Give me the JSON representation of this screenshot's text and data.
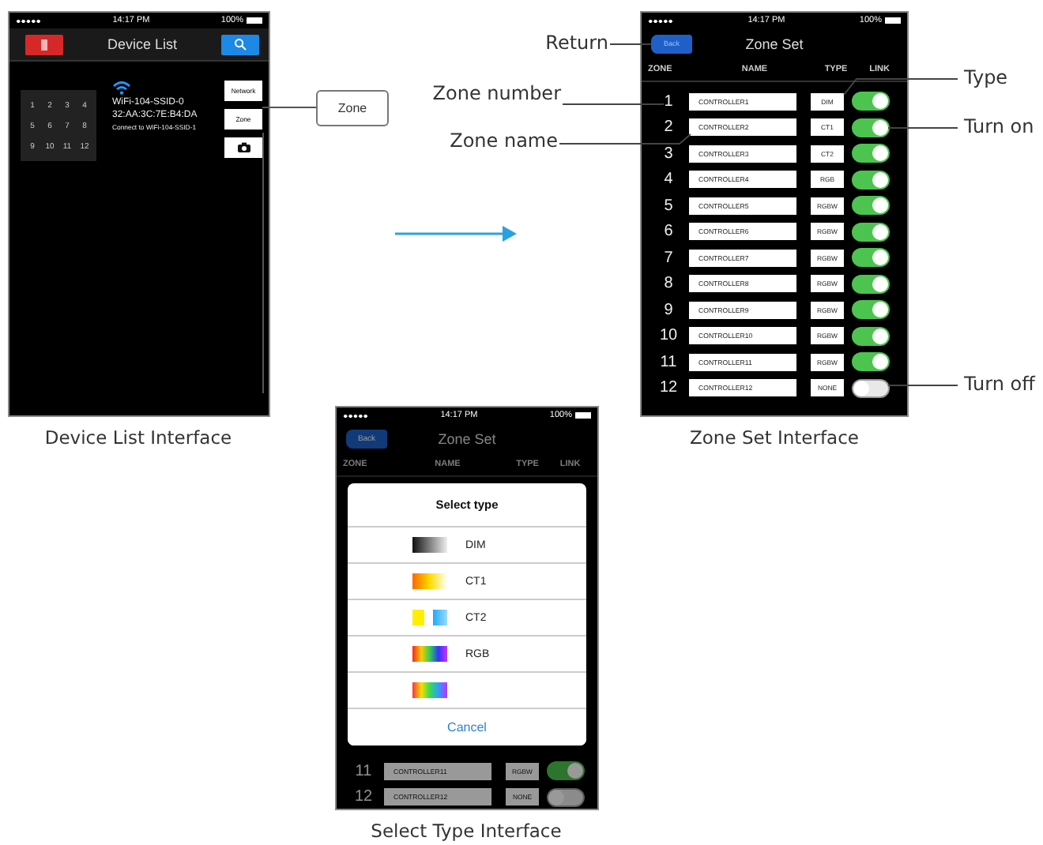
{
  "device_list_screen": {
    "status_bar": {
      "time": "14:17 PM",
      "battery": "100%"
    },
    "title": "Device List",
    "zone_grid": [
      "1",
      "2",
      "3",
      "4",
      "5",
      "6",
      "7",
      "8",
      "9",
      "10",
      "11",
      "12"
    ],
    "device": {
      "ssid": "WiFi-104-SSID-0",
      "mac": "32:AA:3C:7E:B4:DA",
      "connection": "Connect to WiFi-104-SSID-1"
    },
    "side_buttons": [
      {
        "kind": "text",
        "label": "Network"
      },
      {
        "kind": "text",
        "label": "Zone"
      },
      {
        "kind": "camera"
      }
    ],
    "caption": "Device List Interface"
  },
  "zone_callout": "Zone",
  "zone_set_screen": {
    "status_bar": {
      "time": "14:17 PM",
      "battery": "100%"
    },
    "back_button": "Back",
    "title": "Zone Set",
    "columns": [
      "ZONE",
      "NAME",
      "TYPE",
      "LINK"
    ],
    "rows": [
      {
        "zone": "1",
        "name": "CONTROLLER1",
        "type": "DIM",
        "on": true
      },
      {
        "zone": "2",
        "name": "CONTROLLER2",
        "type": "CT1",
        "on": true
      },
      {
        "zone": "3",
        "name": "CONTROLLER3",
        "type": "CT2",
        "on": true
      },
      {
        "zone": "4",
        "name": "CONTROLLER4",
        "type": "RGB",
        "on": true
      },
      {
        "zone": "5",
        "name": "CONTROLLER5",
        "type": "RGBW",
        "on": true
      },
      {
        "zone": "6",
        "name": "CONTROLLER6",
        "type": "RGBW",
        "on": true
      },
      {
        "zone": "7",
        "name": "CONTROLLER7",
        "type": "RGBW",
        "on": true
      },
      {
        "zone": "8",
        "name": "CONTROLLER8",
        "type": "RGBW",
        "on": true
      },
      {
        "zone": "9",
        "name": "CONTROLLER9",
        "type": "RGBW",
        "on": true
      },
      {
        "zone": "10",
        "name": "CONTROLLER10",
        "type": "RGBW",
        "on": true
      },
      {
        "zone": "11",
        "name": "CONTROLLER11",
        "type": "RGBW",
        "on": true
      },
      {
        "zone": "12",
        "name": "CONTROLLER12",
        "type": "NONE",
        "on": false
      }
    ],
    "caption": "Zone Set Interface"
  },
  "annotations": [
    "Return",
    "Zone number",
    "Zone name",
    "Type",
    "Turn on",
    "Turn off"
  ],
  "select_type_screen": {
    "status_bar": {
      "time": "14:17 PM",
      "battery": "100%"
    },
    "back_button": "Back",
    "title": "Zone Set",
    "columns": [
      "ZONE",
      "NAME",
      "TYPE",
      "LINK"
    ],
    "sheet": {
      "title": "Select type",
      "options": [
        {
          "kind": "dim",
          "label": "DIM"
        },
        {
          "kind": "ct1",
          "label": "CT1"
        },
        {
          "kind": "ct2",
          "label": "CT2"
        },
        {
          "kind": "rgb",
          "label": "RGB"
        },
        {
          "kind": "rgbw"
        }
      ],
      "cancel": "Cancel"
    },
    "rows": [
      {
        "zone": "11",
        "name": "CONTROLLER11",
        "type": "RGBW",
        "on": true
      },
      {
        "zone": "12",
        "name": "CONTROLLER12",
        "type": "NONE",
        "on": false
      }
    ],
    "caption": "Select Type Interface"
  }
}
